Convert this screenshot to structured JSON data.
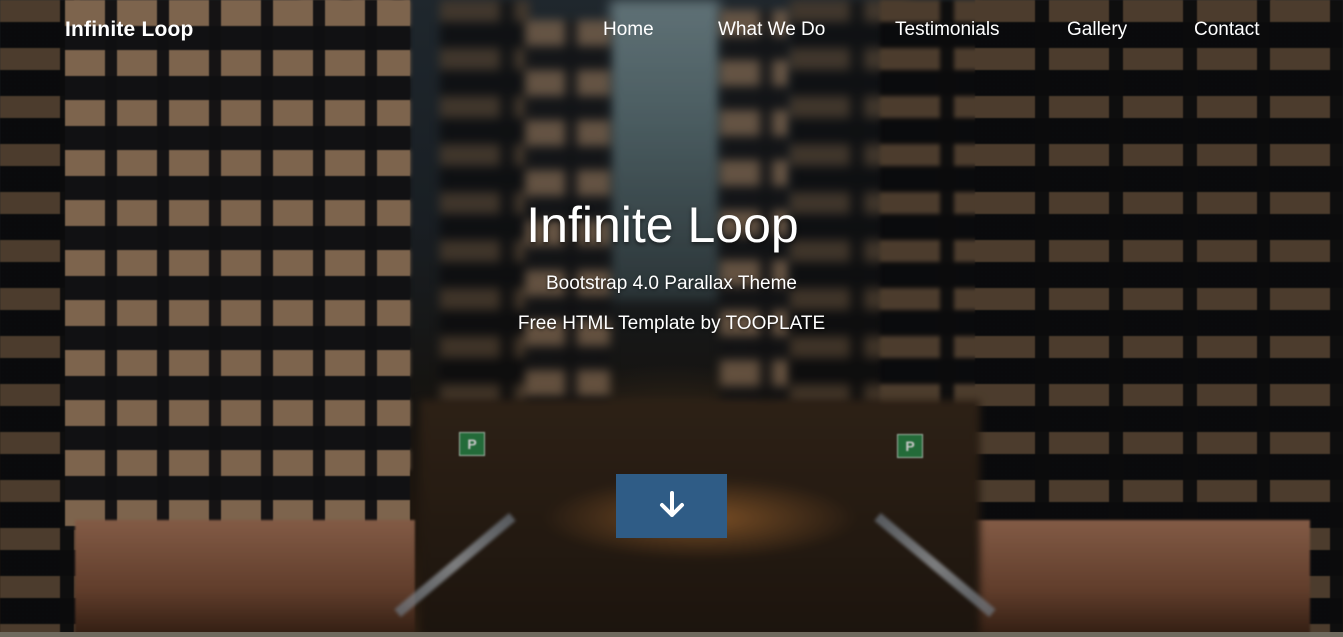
{
  "brand": {
    "name": "Infinite Loop"
  },
  "nav": {
    "items": [
      {
        "label": "Home"
      },
      {
        "label": "What We Do"
      },
      {
        "label": "Testimonials"
      },
      {
        "label": "Gallery"
      },
      {
        "label": "Contact"
      }
    ]
  },
  "hero": {
    "title": "Infinite Loop",
    "subtitle": "Bootstrap 4.0 Parallax Theme",
    "credit": "Free HTML Template by TOOPLATE",
    "scroll_button_icon": "arrow-down-icon"
  },
  "signs": [
    {
      "label": "P"
    },
    {
      "label": "P"
    }
  ],
  "colors": {
    "accent": "#2f5c86",
    "text": "#ffffff"
  }
}
